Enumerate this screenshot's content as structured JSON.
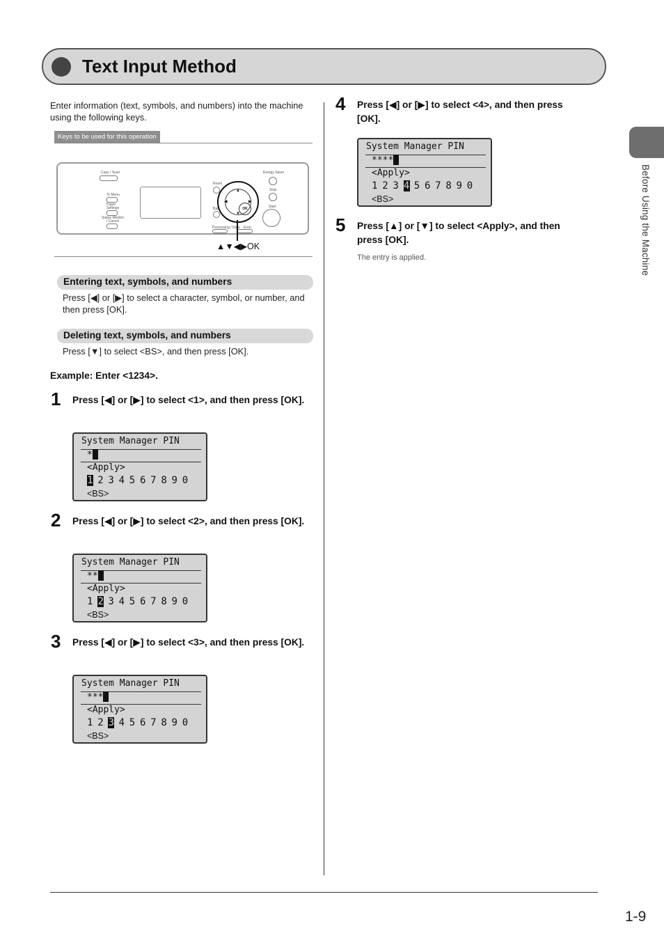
{
  "header": {
    "title": "Text Input Method"
  },
  "side_tab": {
    "label": "Before Using the Machine"
  },
  "intro": "Enter information (text, symbols, and numbers) into the machine using the following keys.",
  "keys_tag": "Keys to be used for this operation",
  "panel": {
    "labels": {
      "copy_scan": "Copy / Scan",
      "menu": "Ⓜ Menu",
      "paper_settings": "Paper Settings",
      "status_monitor": "Status Monitor / Cancel",
      "reset": "Reset",
      "back": "Back",
      "energy_saver": "Energy Saver",
      "stop": "Stop",
      "start": "Start",
      "processing_data": "Processing / Data",
      "error": "Error",
      "ok": "OK"
    },
    "caption": "▲▼◀▶OK"
  },
  "sections": [
    {
      "heading": "Entering text, symbols, and numbers",
      "body": "Press [◀] or [▶] to select a character, symbol, or number, and then press [OK]."
    },
    {
      "heading": "Deleting text, symbols, and numbers",
      "body": "Press [▼] to select <BS>, and then press [OK]."
    }
  ],
  "example": "Example: Enter <1234>.",
  "lcd_common": {
    "title": "System Manager PIN",
    "apply": "<Apply>",
    "bs": "<BS>",
    "digits": [
      "1",
      "2",
      "3",
      "4",
      "5",
      "6",
      "7",
      "8",
      "9",
      "0"
    ]
  },
  "steps": [
    {
      "num": "1",
      "text": "Press [◀] or [▶] to select <1>, and then press [OK].",
      "pin": "*",
      "selected": 0
    },
    {
      "num": "2",
      "text": "Press [◀] or [▶] to select <2>, and then press [OK].",
      "pin": "**",
      "selected": 1
    },
    {
      "num": "3",
      "text": "Press [◀] or [▶] to select <3>, and then press [OK].",
      "pin": "***",
      "selected": 2
    },
    {
      "num": "4",
      "text": "Press [◀] or [▶] to select <4>, and then press [OK].",
      "pin": "****",
      "selected": 3
    },
    {
      "num": "5",
      "text": "Press [▲] or [▼] to select <Apply>, and then press [OK]."
    }
  ],
  "step5_note": "The entry is applied.",
  "footer": {
    "page_number": "1-9"
  }
}
